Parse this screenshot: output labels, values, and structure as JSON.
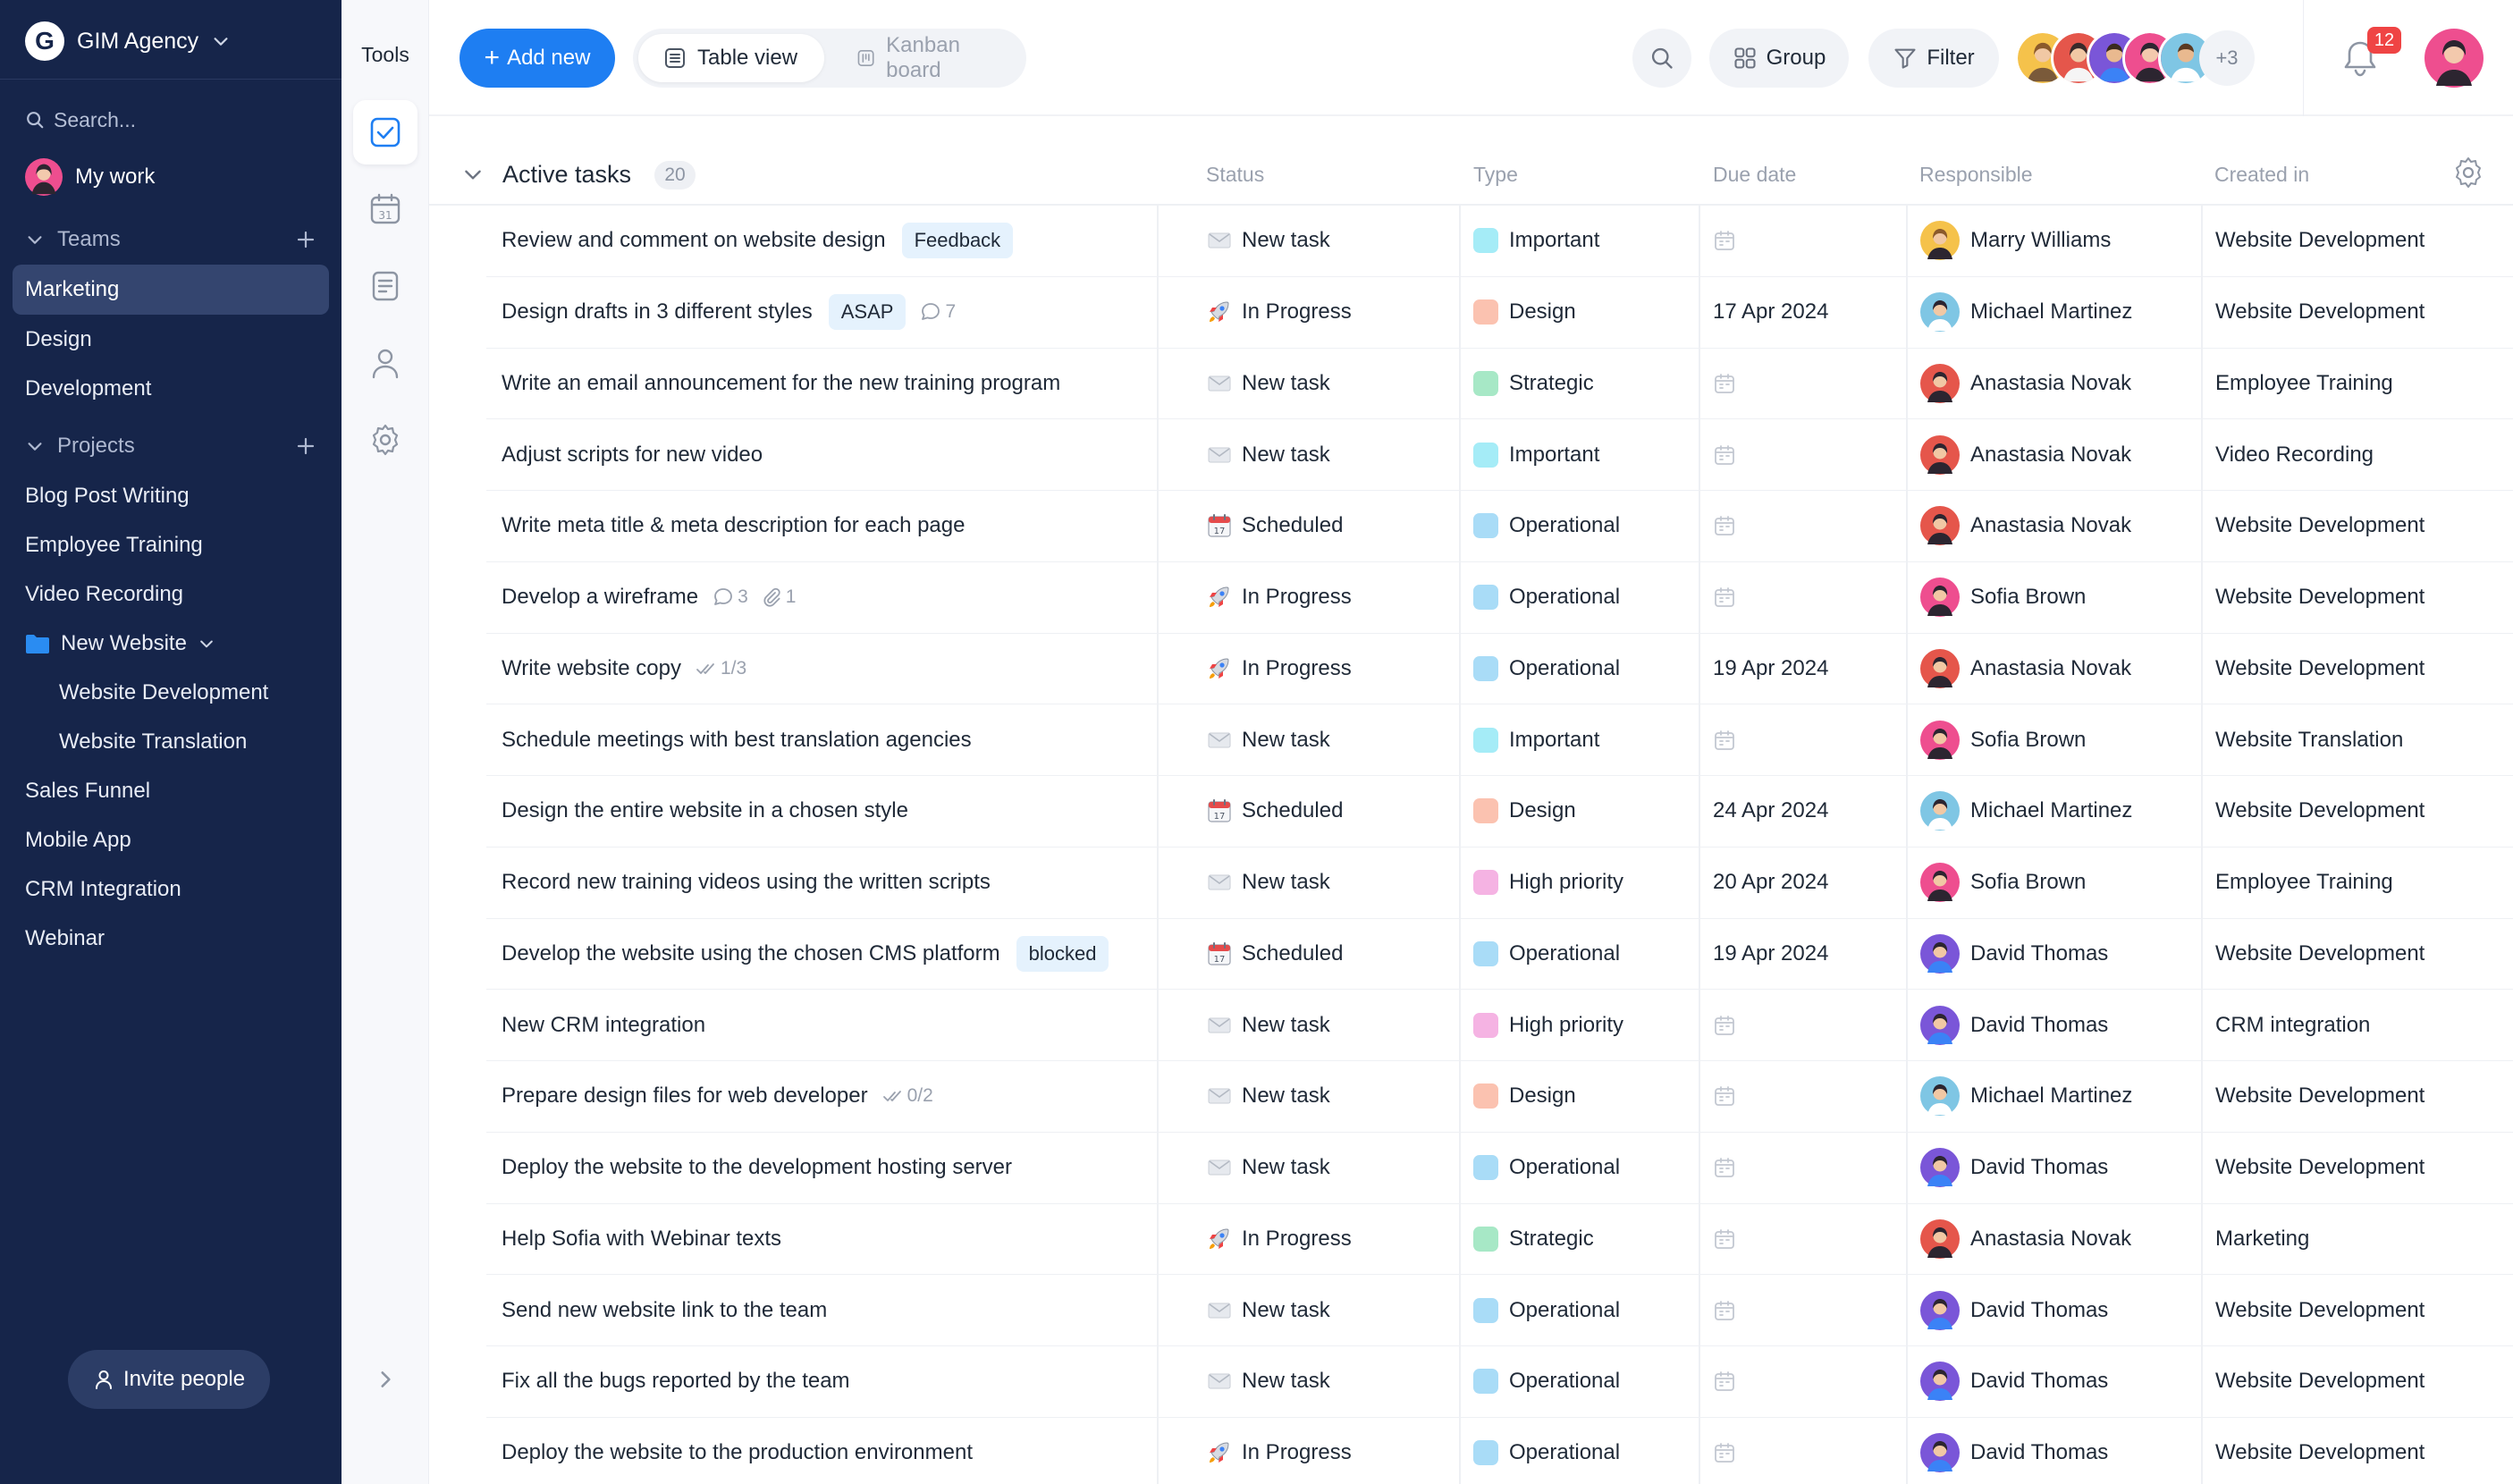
{
  "workspace": {
    "name": "GIM Agency",
    "logo_letter": "G"
  },
  "sidebar": {
    "search_placeholder": "Search...",
    "my_work": "My work",
    "teams_label": "Teams",
    "teams": [
      "Marketing",
      "Design",
      "Development"
    ],
    "projects_label": "Projects",
    "projects": [
      "Blog Post Writing",
      "Employee Training",
      "Video Recording",
      "New Website",
      "Website Development",
      "Website Translation",
      "Sales Funnel",
      "Mobile App",
      "CRM Integration",
      "Webinar"
    ],
    "invite_label": "Invite people"
  },
  "tools": {
    "title": "Tools"
  },
  "toolbar": {
    "add_new": "Add new",
    "table_view": "Table view",
    "kanban_board": "Kanban board",
    "group": "Group",
    "filter": "Filter",
    "more_members": "+3",
    "notifications": "12"
  },
  "table": {
    "group_title": "Active tasks",
    "group_count": "20",
    "columns": {
      "status": "Status",
      "type": "Type",
      "due": "Due date",
      "responsible": "Responsible",
      "created": "Created in"
    },
    "rows": [
      {
        "title": "Review and comment on website design",
        "tag": "Feedback",
        "status": "New task",
        "type": "Important",
        "due": "",
        "responsible": "Marry Williams",
        "created": "Website Development"
      },
      {
        "title": "Design drafts in 3 different styles",
        "tag": "ASAP",
        "comments": "7",
        "status": "In Progress",
        "type": "Design",
        "due": "17 Apr 2024",
        "responsible": "Michael Martinez",
        "created": "Website Development"
      },
      {
        "title": "Write an email announcement for the new training program",
        "status": "New task",
        "type": "Strategic",
        "due": "",
        "responsible": "Anastasia Novak",
        "created": "Employee Training"
      },
      {
        "title": "Adjust scripts for new video",
        "status": "New task",
        "type": "Important",
        "due": "",
        "responsible": "Anastasia Novak",
        "created": "Video Recording"
      },
      {
        "title": "Write meta title & meta description for each page",
        "status": "Scheduled",
        "type": "Operational",
        "due": "",
        "responsible": "Anastasia Novak",
        "created": "Website Development"
      },
      {
        "title": "Develop a wireframe",
        "comments": "3",
        "attachments": "1",
        "status": "In Progress",
        "type": "Operational",
        "due": "",
        "responsible": "Sofia Brown",
        "created": "Website Development"
      },
      {
        "title": "Write website copy",
        "checklist": "1/3",
        "status": "In Progress",
        "type": "Operational",
        "due": "19 Apr 2024",
        "responsible": "Anastasia Novak",
        "created": "Website Development"
      },
      {
        "title": "Schedule meetings with best translation agencies",
        "status": "New task",
        "type": "Important",
        "due": "",
        "responsible": "Sofia Brown",
        "created": "Website Translation"
      },
      {
        "title": "Design the entire website in a chosen style",
        "status": "Scheduled",
        "type": "Design",
        "due": "24 Apr 2024",
        "responsible": "Michael Martinez",
        "created": "Website Development"
      },
      {
        "title": "Record new training videos using the written scripts",
        "status": "New task",
        "type": "High priority",
        "due": "20 Apr 2024",
        "responsible": "Sofia Brown",
        "created": "Employee Training"
      },
      {
        "title": "Develop the website using the chosen CMS platform",
        "tag": "blocked",
        "status": "Scheduled",
        "type": "Operational",
        "due": "19 Apr 2024",
        "responsible": "David Thomas",
        "created": "Website Development"
      },
      {
        "title": "New CRM integration",
        "status": "New task",
        "type": "High priority",
        "due": "",
        "responsible": "David Thomas",
        "created": "CRM integration"
      },
      {
        "title": "Prepare design files for web developer",
        "checklist": "0/2",
        "status": "New task",
        "type": "Design",
        "due": "",
        "responsible": "Michael Martinez",
        "created": "Website Development"
      },
      {
        "title": "Deploy the website to the development hosting server",
        "status": "New task",
        "type": "Operational",
        "due": "",
        "responsible": "David Thomas",
        "created": "Website Development"
      },
      {
        "title": "Help Sofia with Webinar texts",
        "status": "In Progress",
        "type": "Strategic",
        "due": "",
        "responsible": "Anastasia Novak",
        "created": "Marketing"
      },
      {
        "title": "Send new website link to the team",
        "status": "New task",
        "type": "Operational",
        "due": "",
        "responsible": "David Thomas",
        "created": "Website Development"
      },
      {
        "title": "Fix all the bugs reported by the team",
        "status": "New task",
        "type": "Operational",
        "due": "",
        "responsible": "David Thomas",
        "created": "Website Development"
      },
      {
        "title": "Deploy the website to the production environment",
        "status": "In Progress",
        "type": "Operational",
        "due": "",
        "responsible": "David Thomas",
        "created": "Website Development"
      }
    ]
  },
  "type_colors": {
    "Important": "#a5ecf7",
    "Design": "#fbc2b0",
    "Strategic": "#a7e8c6",
    "Operational": "#a9dcf7",
    "High priority": "#f5b3e3"
  },
  "avatar_colors": {
    "Marry Williams": "#f5c24b",
    "Michael Martinez": "#7fc6e4",
    "Anastasia Novak": "#e5564b",
    "Sofia Brown": "#ee4e8f",
    "David Thomas": "#7a56d8"
  },
  "colors": {
    "sidebar_bg": "#16254a",
    "accent": "#1e7ef2",
    "badge": "#ef4444"
  }
}
